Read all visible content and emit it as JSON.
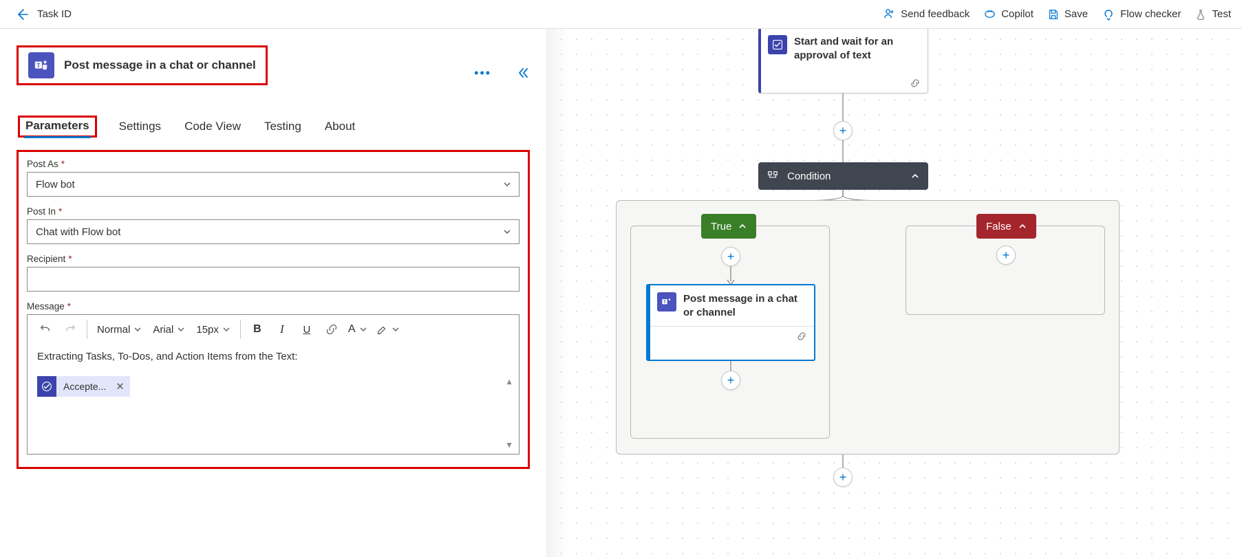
{
  "topbar": {
    "breadcrumb": "Task ID",
    "actions": {
      "feedback": "Send feedback",
      "copilot": "Copilot",
      "save": "Save",
      "flowchecker": "Flow checker",
      "test": "Test"
    }
  },
  "action": {
    "title": "Post message in a chat or channel"
  },
  "tabs": {
    "parameters": "Parameters",
    "settings": "Settings",
    "codeview": "Code View",
    "testing": "Testing",
    "about": "About"
  },
  "params": {
    "postas_label": "Post As",
    "postas_value": "Flow bot",
    "postin_label": "Post In",
    "postin_value": "Chat with Flow bot",
    "recipient_label": "Recipient",
    "recipient_value": "",
    "message_label": "Message",
    "rte": {
      "style": "Normal",
      "font": "Arial",
      "size": "15px"
    },
    "message_text": "Extracting Tasks, To-Dos, and Action Items from the Text:",
    "token_label": "Accepte..."
  },
  "canvas": {
    "approval_title": "Start and wait for an approval of text",
    "condition_label": "Condition",
    "true_label": "True",
    "false_label": "False",
    "post_card_title": "Post message in a chat or channel"
  }
}
